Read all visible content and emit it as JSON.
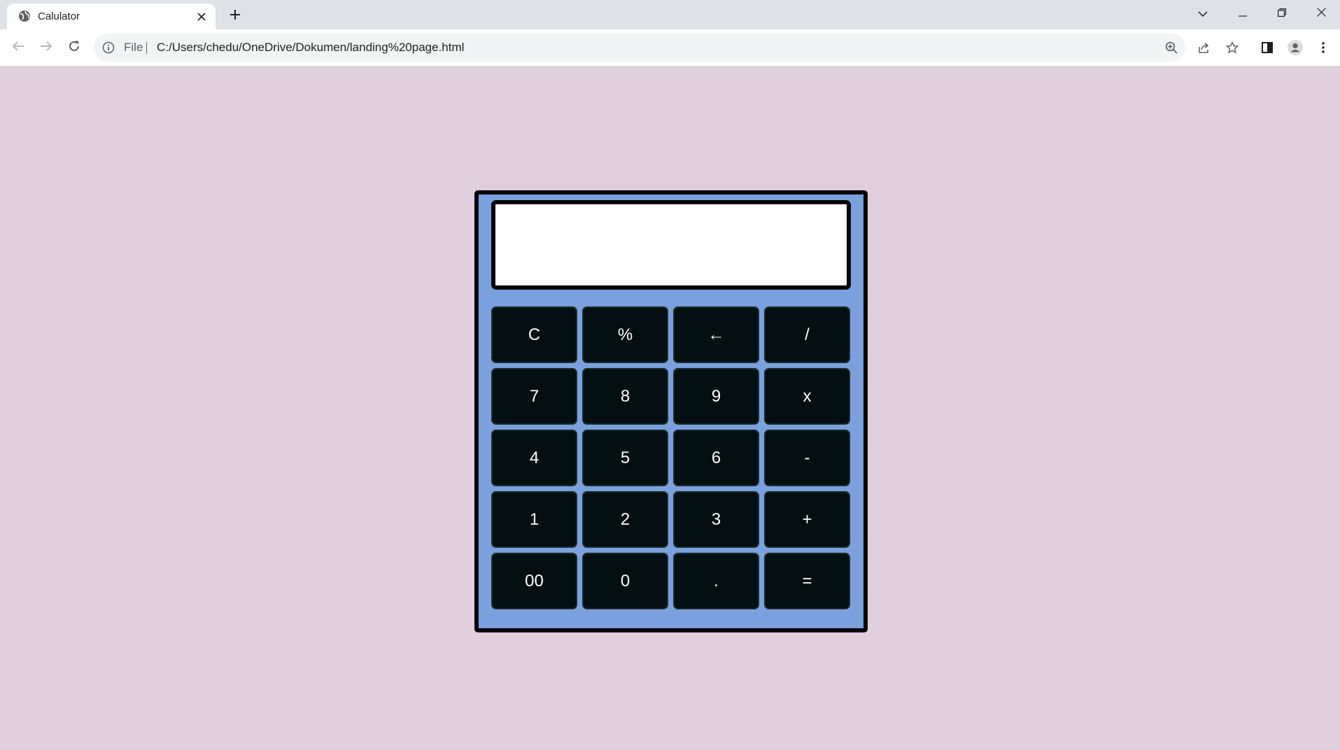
{
  "browser": {
    "tab": {
      "title": "Calulator"
    },
    "address_bar": {
      "scheme_label": "File",
      "url": "C:/Users/chedu/OneDrive/Dokumen/landing%20page.html"
    }
  },
  "calculator": {
    "display": {
      "value": ""
    },
    "keys": [
      {
        "label": "C"
      },
      {
        "label": "%"
      },
      {
        "label": "←"
      },
      {
        "label": "/"
      },
      {
        "label": "7"
      },
      {
        "label": "8"
      },
      {
        "label": "9"
      },
      {
        "label": "x"
      },
      {
        "label": "4"
      },
      {
        "label": "5"
      },
      {
        "label": "6"
      },
      {
        "label": "-"
      },
      {
        "label": "1"
      },
      {
        "label": "2"
      },
      {
        "label": "3"
      },
      {
        "label": "+"
      },
      {
        "label": "00"
      },
      {
        "label": "0"
      },
      {
        "label": "."
      },
      {
        "label": "="
      }
    ]
  },
  "colors": {
    "page_background": "#e0d0dd",
    "calculator_body": "#7aa1de",
    "key_background": "#030f10",
    "key_text": "#ffffff",
    "display_background": "#ffffff"
  },
  "icons": {
    "tab_favicon": "globe-icon",
    "tab_close": "close-icon",
    "new_tab": "plus-icon",
    "tab_search": "chevron-down-icon",
    "minimize": "minimize-icon",
    "restore": "restore-icon",
    "window_close": "close-icon",
    "back": "arrow-left-icon",
    "forward": "arrow-right-icon",
    "reload": "reload-icon",
    "site_info": "info-icon",
    "zoom": "zoom-icon",
    "share": "share-icon",
    "bookmark": "star-icon",
    "side_panel": "side-panel-icon",
    "profile": "profile-icon",
    "menu": "more-vertical-icon"
  }
}
